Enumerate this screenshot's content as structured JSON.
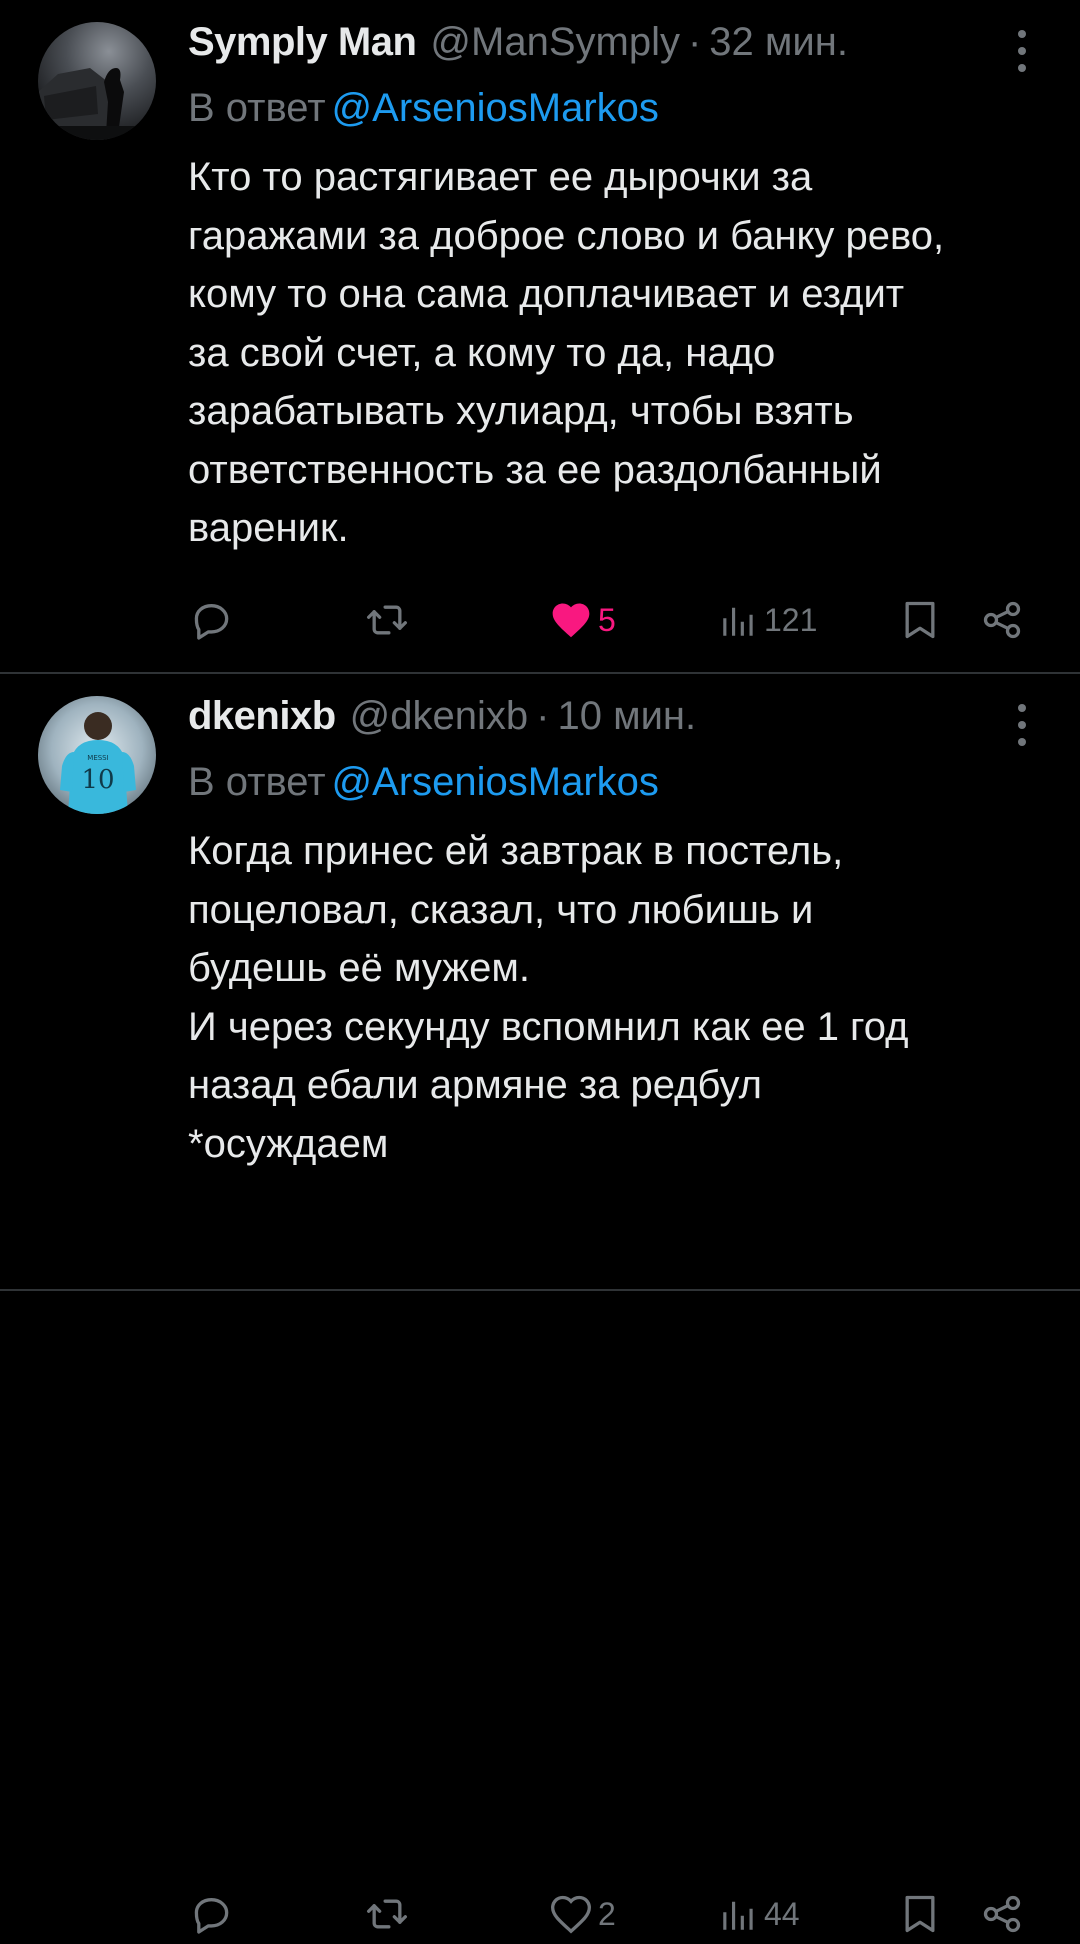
{
  "tweets": [
    {
      "name": "Symply Man",
      "handle": "@ManSymply",
      "separator": "·",
      "time": "32 мин.",
      "reply_prefix": "В ответ",
      "reply_handle": "@ArseniosMarkos",
      "text": "Кто то растягивает ее дырочки за\nгаражами за доброе слово и банку рево,\nкому то она сама доплачивает и ездит\nза свой счет, а кому то да, надо\nзарабатывать хулиард, чтобы взять\nответственность за ее раздолбанный\nвареник.",
      "likes": "5",
      "liked": true,
      "views": "121"
    },
    {
      "name": "dkenixb",
      "handle": "@dkenixb",
      "separator": "·",
      "time": "10 мин.",
      "reply_prefix": "В ответ",
      "reply_handle": "@ArseniosMarkos",
      "text": "Когда принес ей завтрак в постель,\nпоцеловал, сказал, что любишь и\nбудешь её мужем.\nИ через секунду вспомнил как ее 1 год\nназад ебали армяне за редбул\n*осуждаем",
      "likes": "2",
      "liked": false,
      "views": "44"
    }
  ],
  "icons": {
    "reply": "reply-icon",
    "retweet": "retweet-icon",
    "like": "heart-icon",
    "views": "views-icon",
    "bookmark": "bookmark-icon",
    "share": "share-icon",
    "more": "more-vertical-icon"
  },
  "colors": {
    "background": "#000000",
    "text": "#e7e9ea",
    "muted": "#71767b",
    "link": "#1d9bf0",
    "like": "#f91880",
    "divider": "#2f3336"
  }
}
